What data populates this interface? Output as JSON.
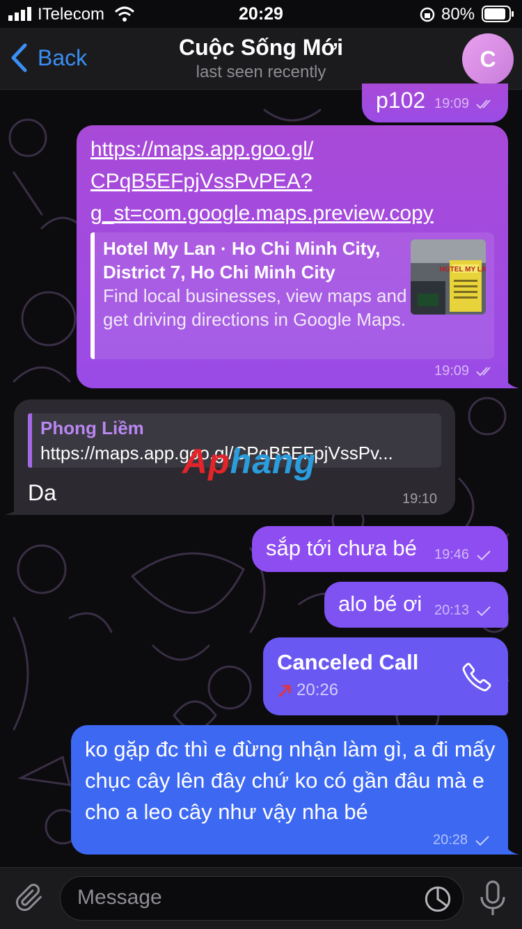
{
  "status_bar": {
    "carrier": "ITelecom",
    "time": "20:29",
    "battery": "80%"
  },
  "header": {
    "back_label": "Back",
    "title": "Cuộc Sống Mới",
    "subtitle": "last seen recently",
    "avatar_letter": "C"
  },
  "messages": [
    {
      "text": "p102",
      "time": "19:09",
      "status": "read"
    },
    {
      "link_line1": "https://maps.app.goo.gl/",
      "link_line2": "CPqB5EFpjVssPvPEA?",
      "link_line3": "g_st=com.google.maps.preview.copy",
      "preview_title": "Hotel My Lan · Ho Chi Minh City, District 7, Ho Chi Minh City",
      "preview_desc": "Find local businesses, view maps and get driving directions in Google Maps.",
      "preview_thumb_text": "HOTEL MY LAN",
      "time": "19:09",
      "status": "read"
    },
    {
      "reply_name": "Phong Liềm",
      "reply_text": "https://maps.app.goo.gl/CPqB5EFpjVssPv...",
      "text": "Da",
      "time": "19:10"
    },
    {
      "text": "sắp tới chưa bé",
      "time": "19:46",
      "status": "sent"
    },
    {
      "text": "alo bé ơi",
      "time": "20:13",
      "status": "sent"
    },
    {
      "title": "Canceled Call",
      "time": "20:26"
    },
    {
      "text": "ko gặp đc thì e đừng nhận làm gì, a đi mấy chục cây lên đây chứ ko có gần đâu mà e cho a leo cây như vậy nha bé",
      "time": "20:28",
      "status": "sent"
    }
  ],
  "watermark": {
    "part1": "Ap",
    "part2": "hang"
  },
  "composer": {
    "placeholder": "Message"
  },
  "colors": {
    "accent_blue": "#3b8ff5",
    "out_purple": "#a94ad8",
    "out_blue": "#3d68f2",
    "in_bubble": "#2c2a30"
  }
}
